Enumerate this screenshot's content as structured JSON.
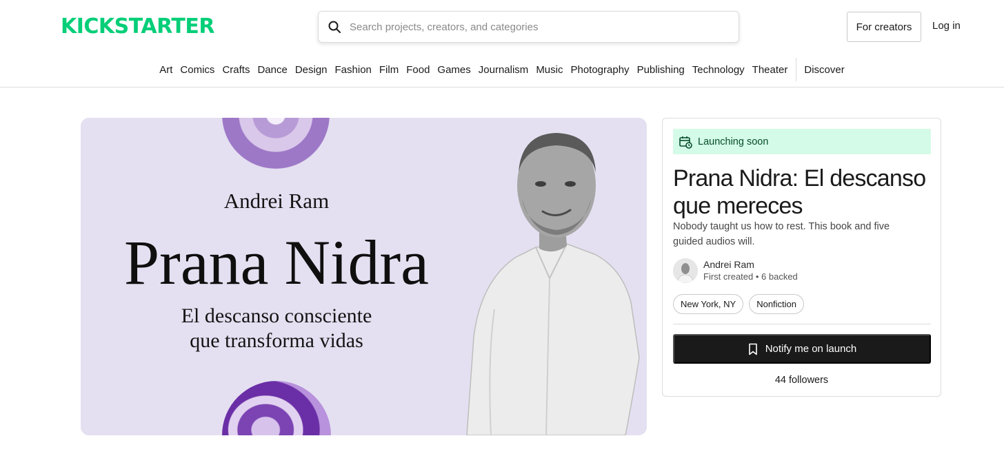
{
  "brand": {
    "logo": "KICKSTARTER",
    "color": "#05ce78"
  },
  "search": {
    "placeholder": "Search projects, creators, and categories",
    "icon": "search-icon"
  },
  "header_actions": {
    "for_creators": "For creators",
    "login": "Log in"
  },
  "categories": [
    "Art",
    "Comics",
    "Crafts",
    "Dance",
    "Design",
    "Fashion",
    "Film",
    "Food",
    "Games",
    "Journalism",
    "Music",
    "Photography",
    "Publishing",
    "Technology",
    "Theater"
  ],
  "discover": "Discover",
  "hero": {
    "author": "Andrei Ram",
    "title": "Prana Nidra",
    "subtitle_line1": "El descanso consciente",
    "subtitle_line2": "que transforma vidas",
    "background": "#e4e0f1"
  },
  "project": {
    "status": "Launching soon",
    "status_icon": "calendar-clock-icon",
    "status_color": "#d4fbe7",
    "title": "Prana Nidra: El descanso que mereces",
    "description": "Nobody taught us how to rest. This book and five guided audios will.",
    "creator": {
      "name": "Andrei Ram",
      "meta": "First created • 6 backed"
    },
    "tags": [
      "New York, NY",
      "Nonfiction"
    ],
    "notify_label": "Notify me on launch",
    "notify_icon": "bookmark-icon",
    "followers": "44 followers"
  }
}
